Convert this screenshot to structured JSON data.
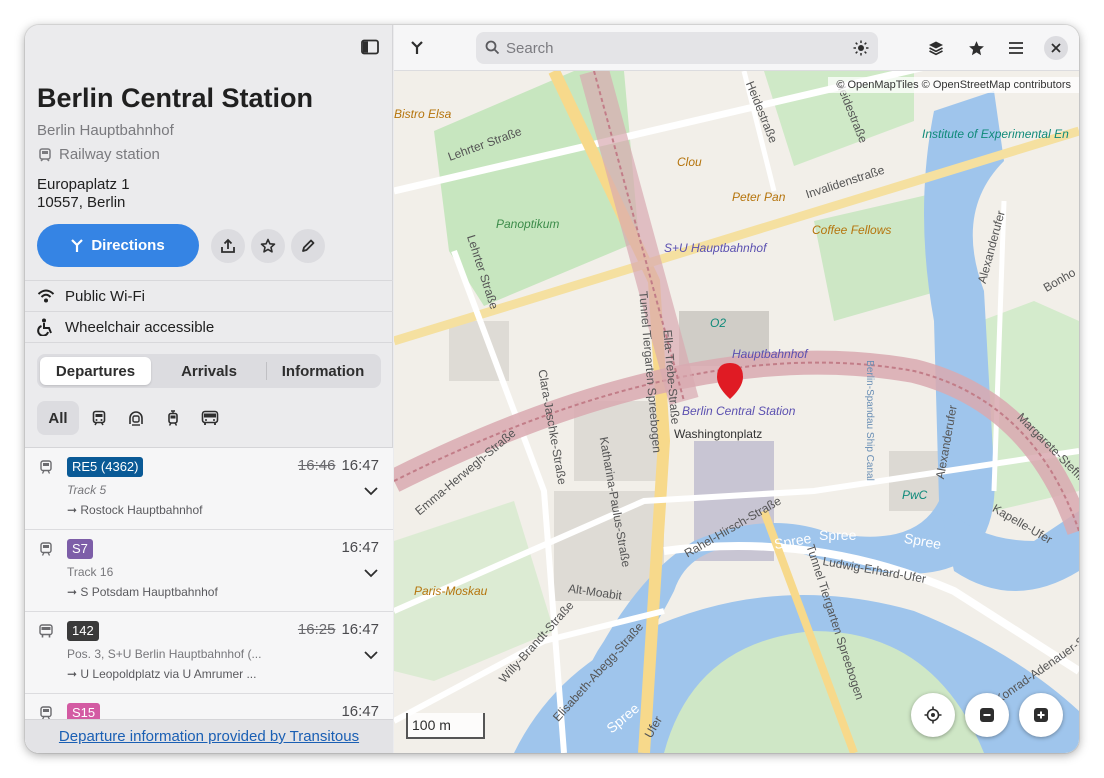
{
  "place": {
    "title": "Berlin Central Station",
    "subtitle": "Berlin Hauptbahnhof",
    "type": "Railway station",
    "address_line1": "Europaplatz 1",
    "address_line2": "10557, Berlin",
    "directions_label": "Directions"
  },
  "amenities": [
    {
      "label": "Public Wi-Fi",
      "icon": "wifi-icon"
    },
    {
      "label": "Wheelchair accessible",
      "icon": "wheelchair-icon"
    }
  ],
  "tabs": [
    {
      "label": "Departures",
      "active": true
    },
    {
      "label": "Arrivals",
      "active": false
    },
    {
      "label": "Information",
      "active": false
    }
  ],
  "filters": {
    "all_label": "All",
    "icons": [
      "train-icon",
      "subway-icon",
      "tram-icon",
      "bus-icon"
    ]
  },
  "departures": [
    {
      "line": "RE5 (4362)",
      "color": "#0a5a96",
      "old_time": "16:46",
      "time": "16:47",
      "track": "Track 5",
      "dest": "Rostock Hauptbahnhof",
      "icon": "train-icon"
    },
    {
      "line": "S7",
      "color": "#7d5ea8",
      "old_time": "",
      "time": "16:47",
      "track": "Track 16",
      "dest": "S Potsdam Hauptbahnhof",
      "icon": "train-icon"
    },
    {
      "line": "142",
      "color": "#3a3a3a",
      "old_time": "16:25",
      "time": "16:47",
      "track": "Pos. 3, S+U Berlin Hauptbahnhof (...",
      "dest": "U Leopoldplatz via U Amrumer ...",
      "icon": "bus-icon"
    },
    {
      "line": "S15",
      "color": "#d35ba3",
      "old_time": "",
      "time": "16:47",
      "track": "",
      "dest": "",
      "icon": "train-icon"
    }
  ],
  "footer": {
    "link": "Departure information provided by Transitous"
  },
  "map": {
    "search_placeholder": "Search",
    "attribution": "© OpenMapTiles © OpenStreetMap contributors",
    "scale_label": "100 m",
    "labels": {
      "bistro": "Bistro Elsa",
      "lehrter": "Lehrter Straße",
      "lehrter2": "Lehrter Straße",
      "heide": "Heidestraße",
      "heide2": "Heidestraße",
      "institute": "Institute of Experimental En",
      "clou": "Clou",
      "peter": "Peter Pan",
      "invaliden": "Invalidenstraße",
      "panoptikum": "Panoptikum",
      "coffee": "Coffee Fellows",
      "alexufer": "Alexanderufer",
      "bonho": "Bonho",
      "su_hbf": "S+U Hauptbahnhof",
      "o2": "O2",
      "hbf2": "Hauptbahnhof",
      "tunnel1": "Tunnel Tiergarten Spreebogen",
      "ella": "Ella-Trebe-Straße",
      "clara": "Clara-Jaschke-Straße",
      "central": "Berlin Central Station",
      "washington": "Washingtonplatz",
      "emma": "Emma-Herwegh-Straße",
      "katharina": "Katharina-Paulus-Straße",
      "kanal": "Berlin-Spandau Ship Canal",
      "alexufer2": "Alexanderufer",
      "margarete": "Margarete-Steffin-S",
      "pwc": "PwC",
      "kapelle": "Kapelle-Ufer",
      "rahel": "Rahel-Hirsch-Straße",
      "spree1": "Spree",
      "spree2": "Spree",
      "spree3": "Spree",
      "spree4": "Spree",
      "ludwig": "Ludwig-Erhard-Ufer",
      "paris": "Paris-Moskau",
      "altmoabit": "Alt-Moabit",
      "tunnel2": "Tunnel Tiergarten Spreebogen",
      "elisabeth": "Elisabeth-Abegg-Straße",
      "willy": "Willy-Brandt-Straße",
      "konrad": "Konrad-Adenauer-Straße",
      "ufer": "Ufer"
    }
  }
}
